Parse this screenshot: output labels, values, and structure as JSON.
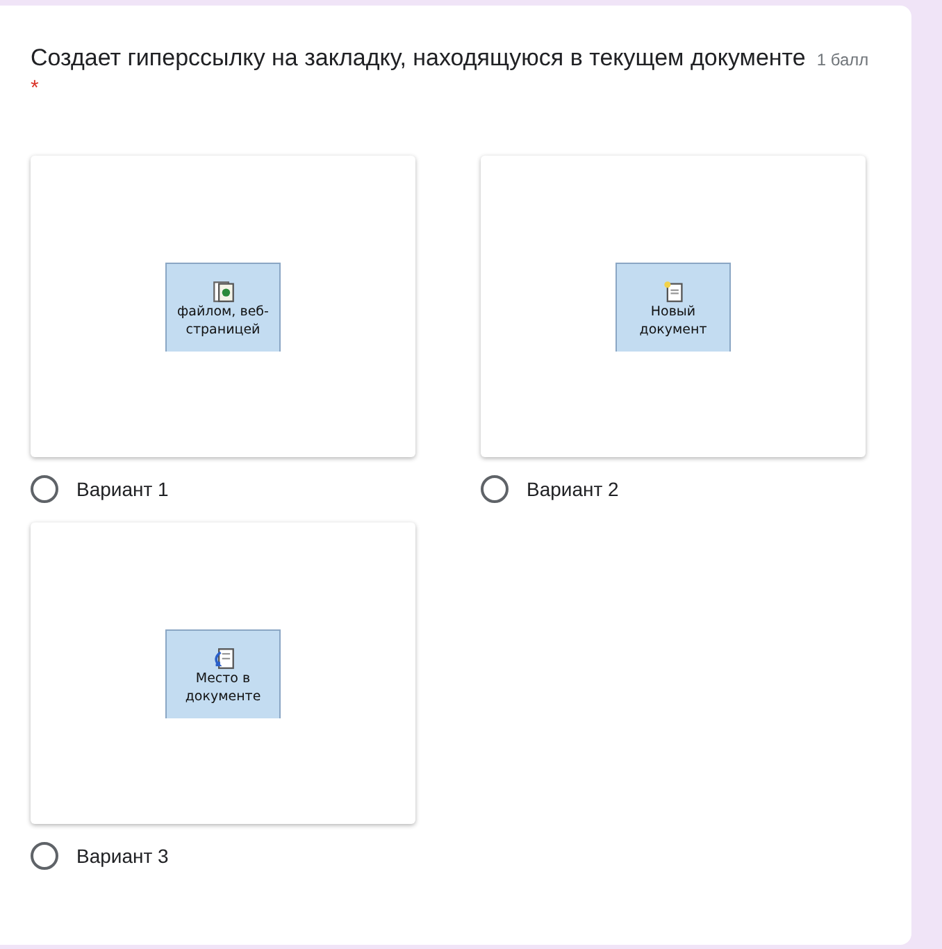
{
  "question": {
    "title": "Создает гиперссылку на закладку, находящуюся в текущем документе",
    "points": "1 балл",
    "required_mark": "*"
  },
  "options": [
    {
      "label": "Вариант 1",
      "selected": false,
      "image": {
        "kind": "file",
        "caption": "файлом, веб-страницей"
      }
    },
    {
      "label": "Вариант 2",
      "selected": false,
      "image": {
        "kind": "new",
        "caption": "Новый документ"
      }
    },
    {
      "label": "Вариант 3",
      "selected": false,
      "image": {
        "kind": "place",
        "caption": "Место в документе"
      }
    }
  ]
}
